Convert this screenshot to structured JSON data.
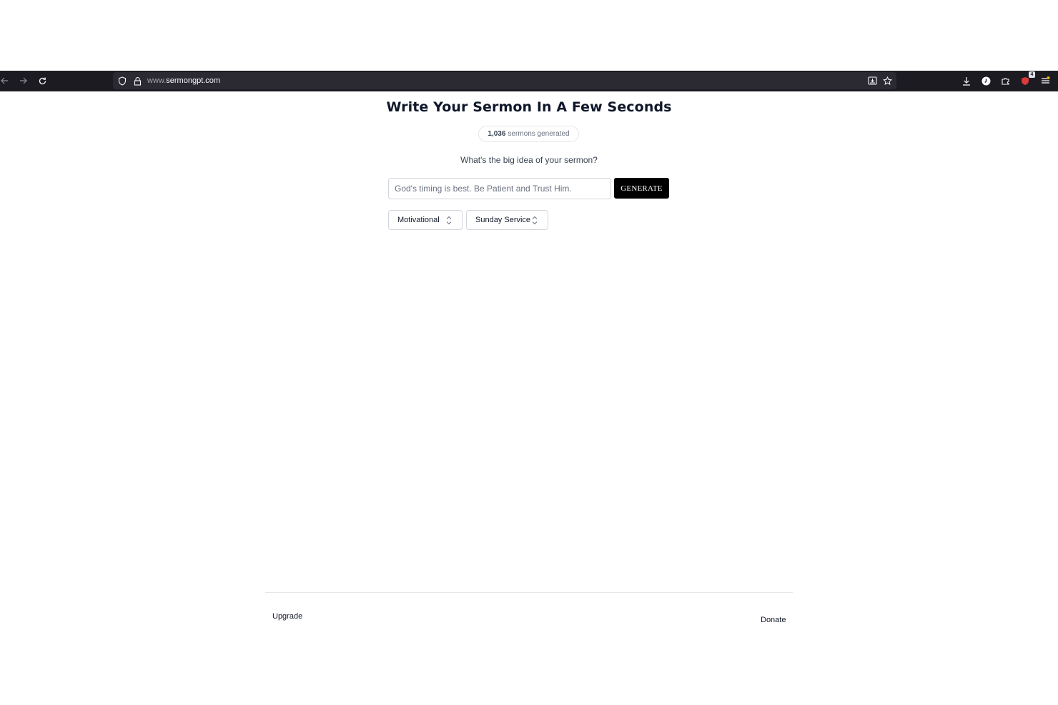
{
  "browser": {
    "url_prefix": "www.",
    "url_domain": "sermongpt.com",
    "extensions_badge": "4"
  },
  "main": {
    "title": "Write Your Sermon In A Few Seconds",
    "counter_number": "1,036",
    "counter_label": "sermons generated",
    "question": "What's the big idea of your sermon?",
    "input_placeholder": "God's timing is best. Be Patient and Trust Him.",
    "generate_label": "GENERATE",
    "tone_select": "Motivational",
    "occasion_select": "Sunday Service"
  },
  "footer": {
    "upgrade": "Upgrade",
    "donate": "Donate"
  },
  "colors": {
    "toolbar_bg": "#1c1b22",
    "button_bg": "#000000",
    "title_text": "#0f172a"
  }
}
